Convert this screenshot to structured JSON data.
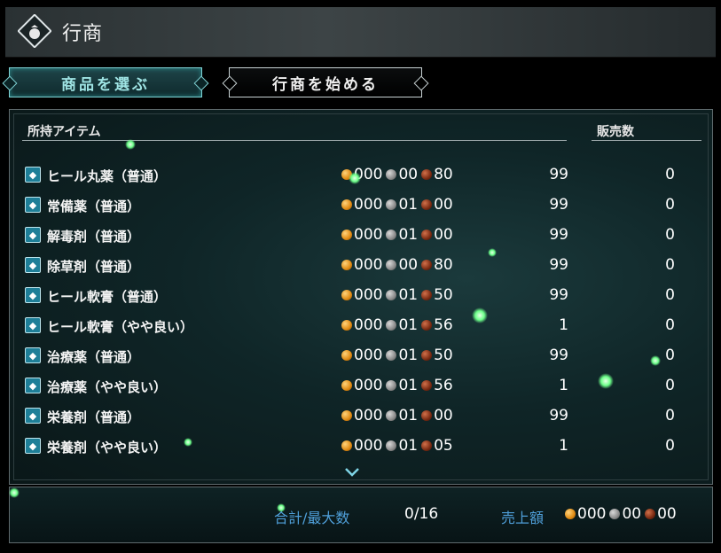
{
  "header": {
    "title": "行商",
    "emblem_icon": "money-bag-icon"
  },
  "tabs": [
    {
      "label": "商品を選ぶ",
      "active": true
    },
    {
      "label": "行商を始める",
      "active": false
    }
  ],
  "columns": {
    "items": "所持アイテム",
    "sales": "販売数"
  },
  "items": [
    {
      "name": "ヒール丸薬（普通）",
      "icon": "pill-bag-icon",
      "gold": "000",
      "silver": "00",
      "copper": "80",
      "stock": "99",
      "sold": "0"
    },
    {
      "name": "常備薬（普通）",
      "icon": "potion-icon",
      "gold": "000",
      "silver": "01",
      "copper": "00",
      "stock": "99",
      "sold": "0"
    },
    {
      "name": "解毒剤（普通）",
      "icon": "antidote-icon",
      "gold": "000",
      "silver": "01",
      "copper": "00",
      "stock": "99",
      "sold": "0"
    },
    {
      "name": "除草剤（普通）",
      "icon": "herbicide-icon",
      "gold": "000",
      "silver": "00",
      "copper": "80",
      "stock": "99",
      "sold": "0"
    },
    {
      "name": "ヒール軟膏（普通）",
      "icon": "ointment-icon",
      "gold": "000",
      "silver": "01",
      "copper": "50",
      "stock": "99",
      "sold": "0"
    },
    {
      "name": "ヒール軟膏（やや良い）",
      "icon": "ointment-icon",
      "gold": "000",
      "silver": "01",
      "copper": "56",
      "stock": "1",
      "sold": "0"
    },
    {
      "name": "治療薬（普通）",
      "icon": "potion-icon",
      "gold": "000",
      "silver": "01",
      "copper": "50",
      "stock": "99",
      "sold": "0"
    },
    {
      "name": "治療薬（やや良い）",
      "icon": "antidote-icon",
      "gold": "000",
      "silver": "01",
      "copper": "56",
      "stock": "1",
      "sold": "0"
    },
    {
      "name": "栄養剤（普通）",
      "icon": "tonic-icon",
      "gold": "000",
      "silver": "01",
      "copper": "00",
      "stock": "99",
      "sold": "0"
    },
    {
      "name": "栄養剤（やや良い）",
      "icon": "potion-icon",
      "gold": "000",
      "silver": "01",
      "copper": "05",
      "stock": "1",
      "sold": "0"
    }
  ],
  "footer": {
    "total_label": "合計/最大数",
    "total_value": "0/16",
    "sales_label": "売上額",
    "sales_gold": "000",
    "sales_silver": "00",
    "sales_copper": "00"
  },
  "colors": {
    "accent": "#7fd4d6",
    "label_blue": "#4f9fd9",
    "icon_bg": "#1e7f98"
  }
}
